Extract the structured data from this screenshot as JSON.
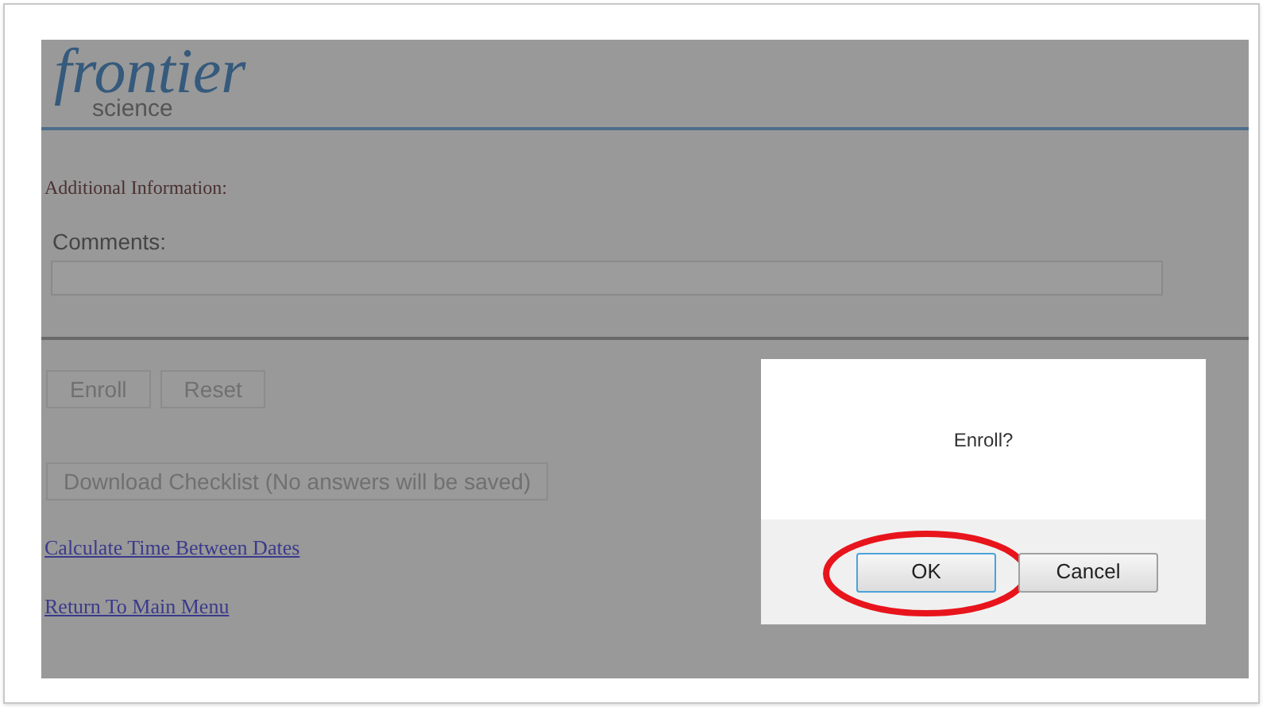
{
  "logo": {
    "wordmark": "frontier",
    "subtitle": "science"
  },
  "section_title": "Additional Information:",
  "comments": {
    "label": "Comments:"
  },
  "form_buttons": [
    {
      "label": "Enroll"
    },
    {
      "label": "Reset"
    }
  ],
  "download_button": "Download Checklist (No answers will be saved)",
  "links": [
    "Calculate Time Between Dates",
    "Return To Main Menu"
  ],
  "dialog": {
    "message": "Enroll?",
    "buttons": [
      {
        "label": "OK",
        "selected": true,
        "highlighted": true
      },
      {
        "label": "Cancel",
        "selected": false,
        "highlighted": false
      }
    ]
  }
}
